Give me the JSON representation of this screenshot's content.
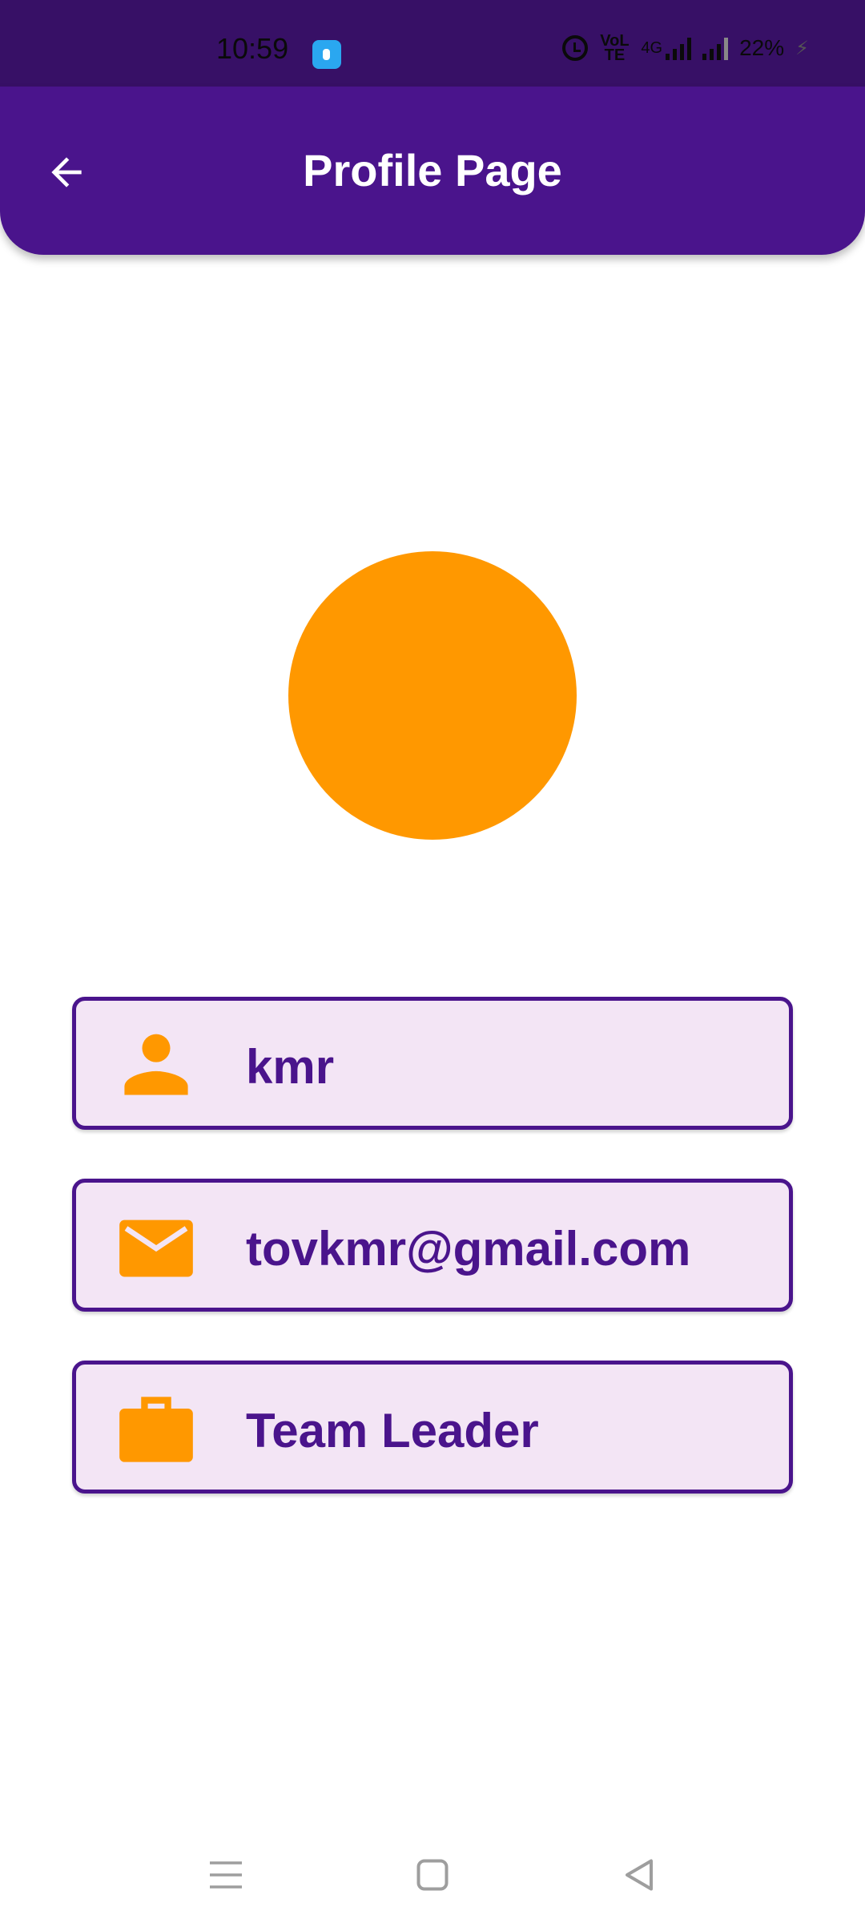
{
  "status_bar": {
    "time": "10:59",
    "network": "4G",
    "volte_label": "VoLTE",
    "battery": "22%",
    "icons": [
      "app-notification-icon",
      "alarm-icon",
      "volte-icon",
      "signal-icon",
      "signal-icon",
      "charging-icon"
    ]
  },
  "header": {
    "title": "Profile Page",
    "back_icon": "arrow-left-icon"
  },
  "profile": {
    "avatar_color": "#ff9800",
    "name": "kmr",
    "email": "tovkmr@gmail.com",
    "role": "Team Leader",
    "icons": {
      "name": "person-icon",
      "email": "mail-icon",
      "role": "briefcase-icon"
    }
  },
  "navigation": {
    "buttons": [
      "menu-icon",
      "home-square-icon",
      "back-triangle-icon"
    ]
  },
  "colors": {
    "primary": "#4a148c",
    "status_bar": "#371066",
    "accent": "#ff9800",
    "card_background": "#f3e5f5"
  }
}
